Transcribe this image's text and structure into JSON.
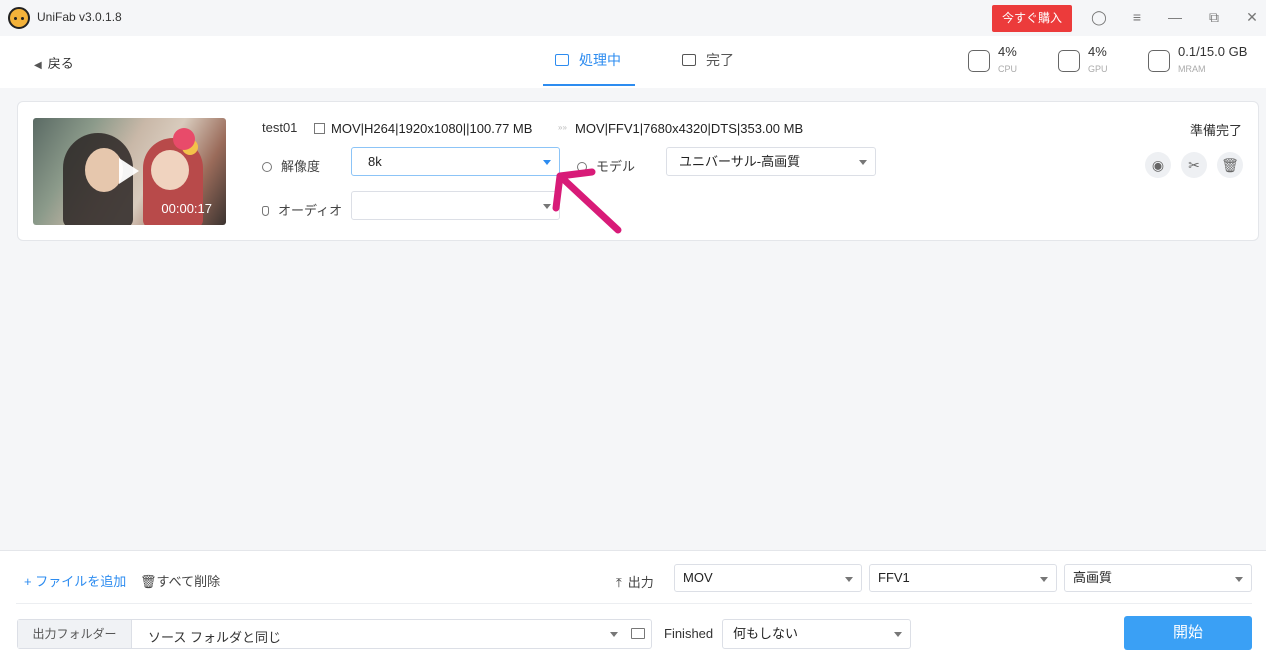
{
  "app": {
    "title": "UniFab v3.0.1.8",
    "buy_label": "今すぐ購入"
  },
  "nav": {
    "back_label": "戻る",
    "tabs": [
      {
        "label": "処理中",
        "active": true
      },
      {
        "label": "完了",
        "active": false
      }
    ],
    "stats": {
      "cpu": {
        "value": "4%",
        "label": "CPU"
      },
      "gpu": {
        "value": "4%",
        "label": "GPU"
      },
      "mram": {
        "value": "0.1/15.0 GB",
        "label": "MRAM"
      }
    }
  },
  "task": {
    "file_name": "test01",
    "duration": "00:00:17",
    "source_info": "MOV|H264|1920x1080||100.77 MB",
    "output_info": "MOV|FFV1|7680x4320|DTS|353.00 MB",
    "status": "準備完了",
    "resolution_label": "解像度",
    "resolution_value": "8k",
    "model_label": "モデル",
    "model_value": "ユニバーサル-高画質",
    "audio_label": "オーディオ",
    "audio_value": ""
  },
  "bottom": {
    "add_file_label": "+ ファイルを追加",
    "delete_all_label": "すべて削除",
    "output_label": "出力",
    "format_value": "MOV",
    "codec_value": "FFV1",
    "quality_value": "高画質",
    "output_folder_label": "出力フォルダー",
    "output_folder_value": "ソース フォルダと同じ",
    "finished_label": "Finished",
    "finished_value": "何もしない",
    "start_label": "開始"
  },
  "colors": {
    "accent": "#2d8cf0",
    "buy": "#ec3b3b",
    "start": "#3aa0f5",
    "annotation": "#d81b78"
  }
}
